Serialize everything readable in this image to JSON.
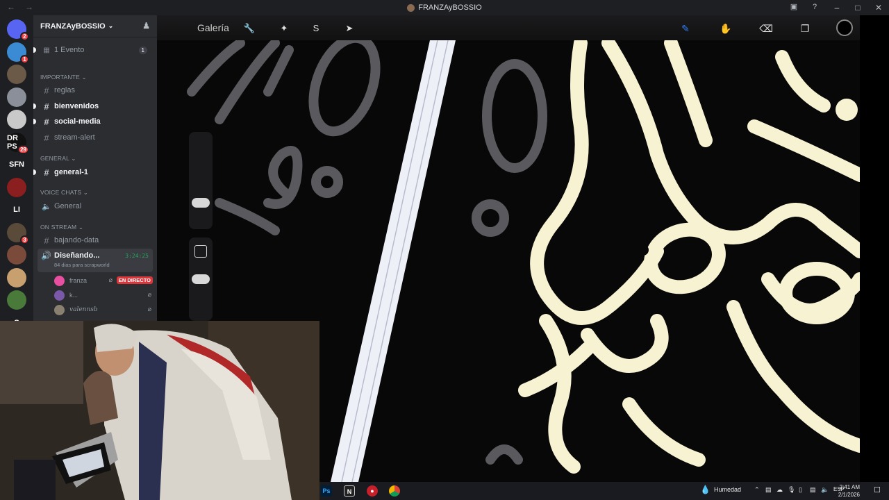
{
  "window": {
    "title": "FRANZAyBOSSIO"
  },
  "servers": [
    {
      "label": "",
      "color": "#5865f2",
      "badge": "2"
    },
    {
      "label": "",
      "color": "#3b8bd4",
      "badge": "1"
    },
    {
      "label": "",
      "color": "#6b5a48",
      "badge": ""
    },
    {
      "label": "",
      "color": "#8a8f99",
      "badge": ""
    },
    {
      "label": "",
      "color": "#c9c9c9",
      "badge": ""
    },
    {
      "label": "DR PS",
      "color": "#111111",
      "badge": "29"
    },
    {
      "label": "SFN",
      "color": "#1e1f22",
      "badge": ""
    },
    {
      "label": "",
      "color": "#8b1e1e",
      "badge": ""
    },
    {
      "label": "LI",
      "color": "#1e1f22",
      "badge": ""
    },
    {
      "label": "",
      "color": "#5a4a3a",
      "badge": "3"
    },
    {
      "label": "",
      "color": "#7a4a3a",
      "badge": ""
    },
    {
      "label": "",
      "color": "#c8a070",
      "badge": ""
    },
    {
      "label": "",
      "color": "#4a7a3a",
      "badge": ""
    },
    {
      "label": "S",
      "color": "#1e1f22",
      "badge": ""
    }
  ],
  "guild": {
    "name": "FRANZAyBOSSIO"
  },
  "events": {
    "label": "1 Evento",
    "count": "1"
  },
  "categories": {
    "importante": "IMPORTANTE",
    "general": "GENERAL",
    "voice": "VOICE CHATS",
    "stream": "ON STREAM"
  },
  "channels": {
    "reglas": "reglas",
    "bienvenidos": "bienvenidos",
    "social": "social-media",
    "stream_alert": "stream-alert",
    "general1": "general-1",
    "voice_general": "General",
    "bajando": "bajando-data"
  },
  "voice_active": {
    "title": "Diseñando...",
    "subtitle": "84 dias para scrapworld",
    "time": "3:24:25"
  },
  "voice_users": [
    {
      "name": "franza",
      "live": "EN DIRECTO",
      "color": "#e84fa0"
    },
    {
      "name": "k...",
      "live": "",
      "color": "#7a5aa8"
    },
    {
      "name": "valennsb",
      "live": "",
      "color": "#8a8070"
    }
  ],
  "procreate": {
    "gallery_label": "Galería",
    "left_tools": [
      "wrench-icon",
      "magic-wand-icon",
      "selection-icon",
      "transform-icon"
    ],
    "right_tools": [
      "brush-icon",
      "smudge-icon",
      "eraser-icon",
      "layers-icon"
    ],
    "active_color": "#000000",
    "accent": "#2f7ef5"
  },
  "taskbar": {
    "weather": "Humedad",
    "language": "ESP",
    "time": "2:41 AM",
    "date": "2/1/2026"
  }
}
